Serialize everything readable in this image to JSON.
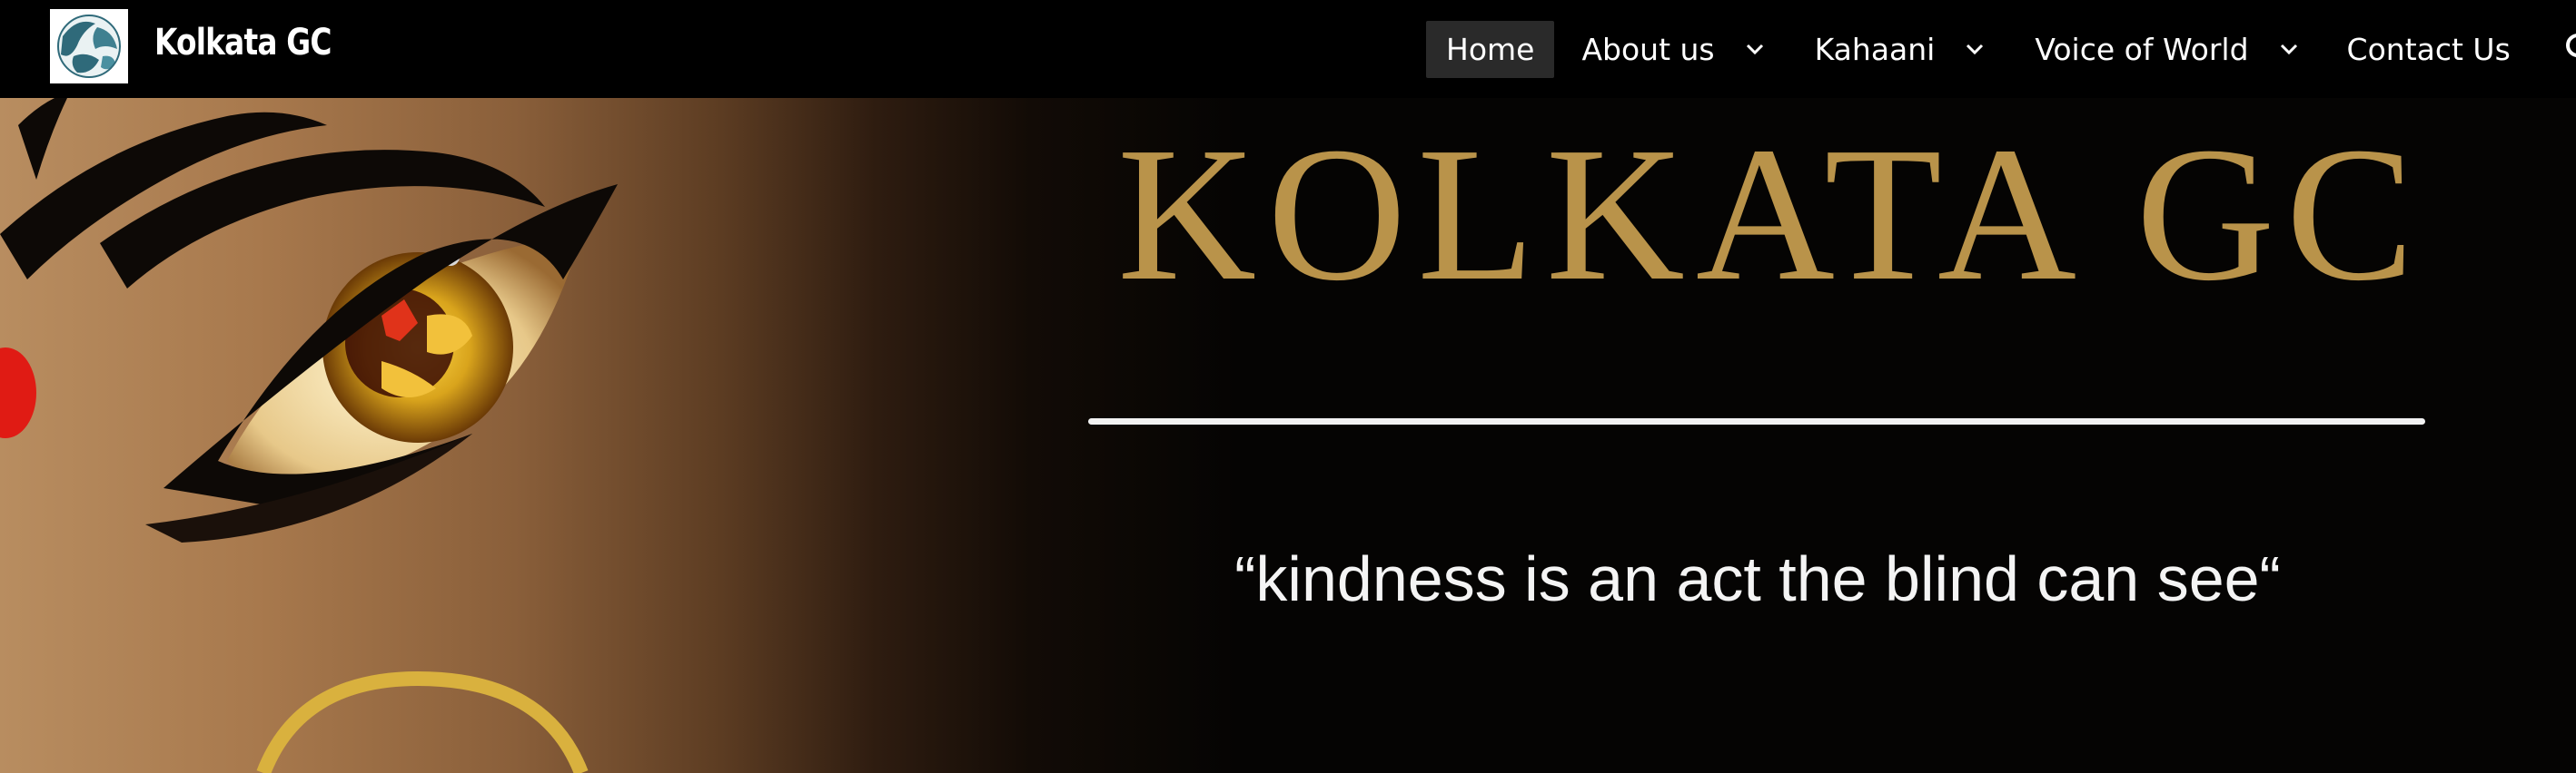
{
  "header": {
    "site_title": "Kolkata GC",
    "logo_icon": "globe-logo-icon"
  },
  "nav": {
    "items": [
      {
        "label": "Home",
        "active": true,
        "has_dropdown": false
      },
      {
        "label": "About us",
        "active": false,
        "has_dropdown": true
      },
      {
        "label": "Kahaani",
        "active": false,
        "has_dropdown": true
      },
      {
        "label": "Voice of World",
        "active": false,
        "has_dropdown": true
      },
      {
        "label": "Contact Us",
        "active": false,
        "has_dropdown": false
      }
    ],
    "search_icon": "search-icon"
  },
  "hero": {
    "title": "KOLKATA GC",
    "quote": "“kindness is an act the blind can see“",
    "title_color": "#b9934a"
  }
}
